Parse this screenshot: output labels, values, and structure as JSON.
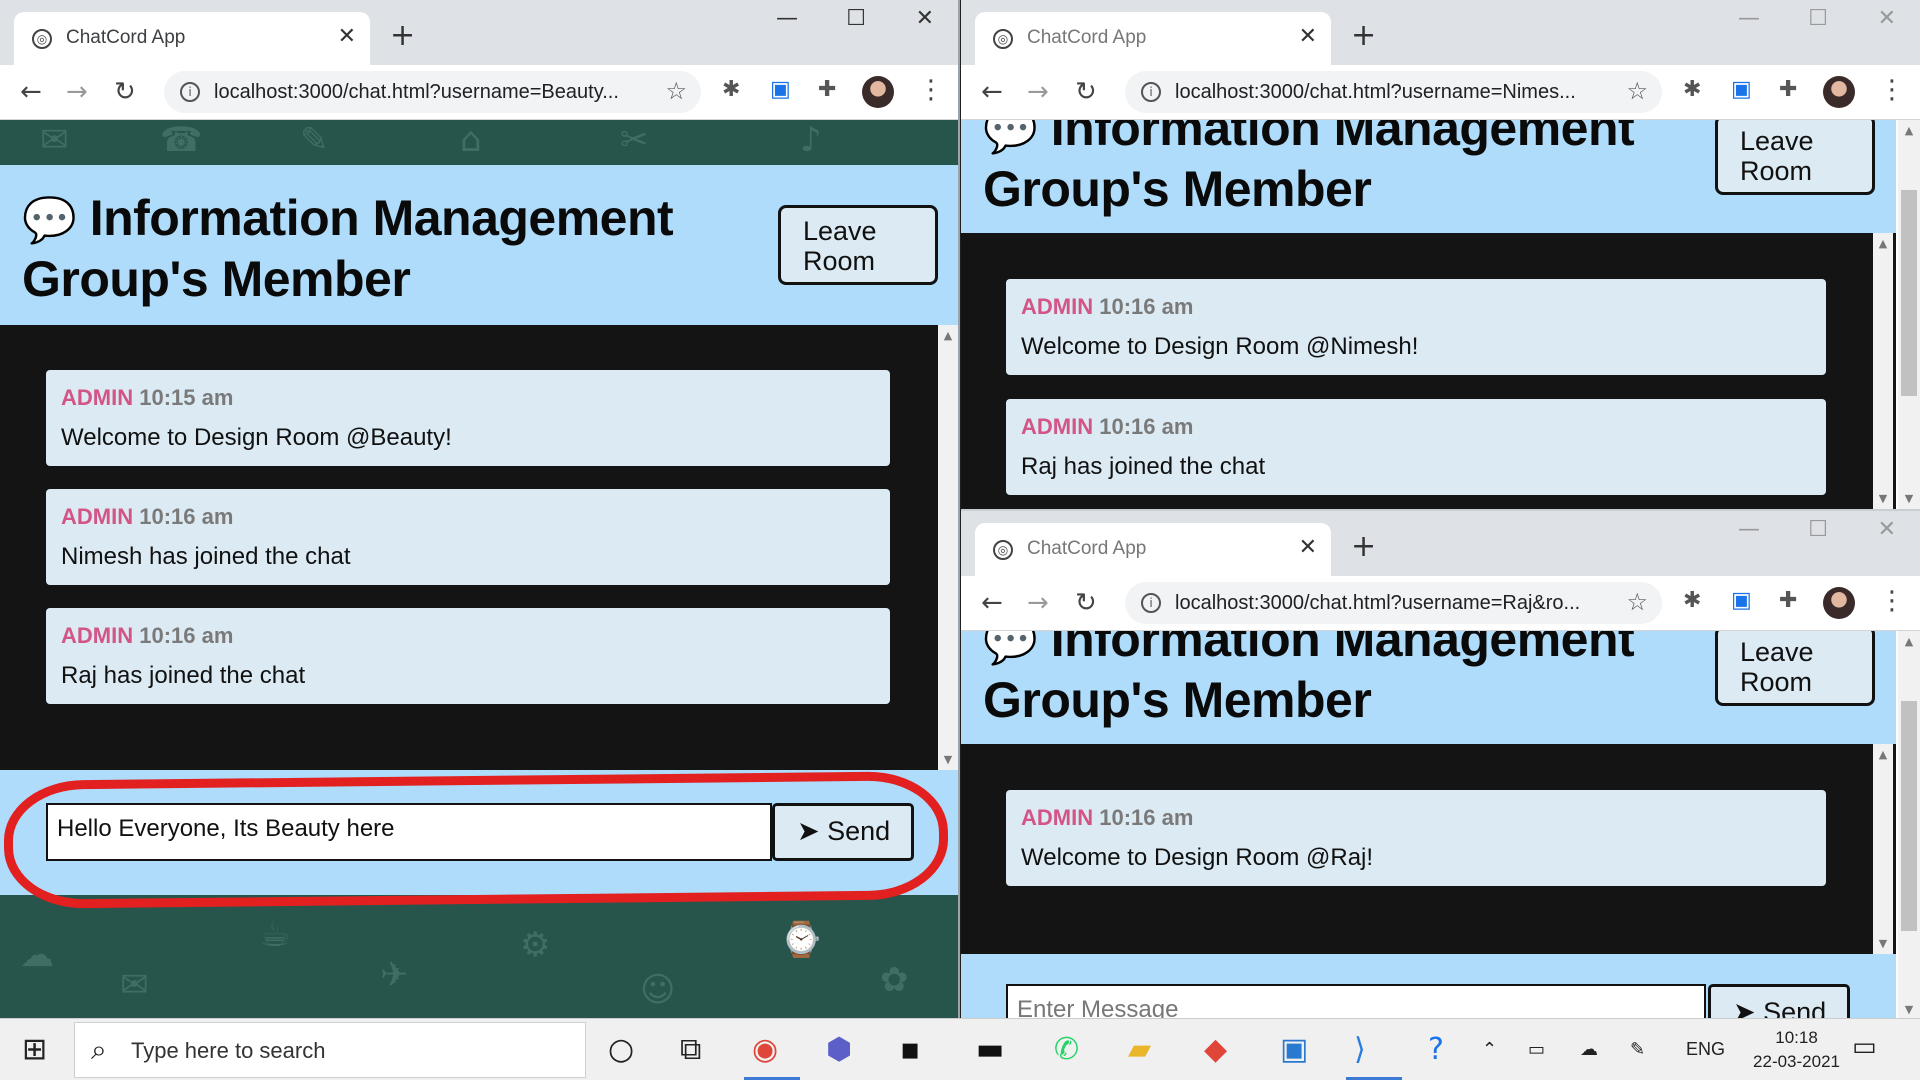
{
  "windows": [
    {
      "tab_title": "ChatCord App",
      "url": "localhost:3000/chat.html?username=Beauty...",
      "header": {
        "line1": "Information Management",
        "line2": "Group's Member",
        "leave": "Leave Room"
      },
      "messages": [
        {
          "user": "ADMIN",
          "time": "10:15 am",
          "text": "Welcome to Design Room @Beauty!"
        },
        {
          "user": "ADMIN",
          "time": "10:16 am",
          "text": "Nimesh has joined the chat"
        },
        {
          "user": "ADMIN",
          "time": "10:16 am",
          "text": "Raj has joined the chat"
        }
      ],
      "input_value": "Hello Everyone, Its Beauty here",
      "send": "Send"
    },
    {
      "tab_title": "ChatCord App",
      "url": "localhost:3000/chat.html?username=Nimes...",
      "header": {
        "line1": "Information Management",
        "line2": "Group's Member",
        "leave": "Leave Room"
      },
      "messages": [
        {
          "user": "ADMIN",
          "time": "10:16 am",
          "text": "Welcome to Design Room @Nimesh!"
        },
        {
          "user": "ADMIN",
          "time": "10:16 am",
          "text": "Raj has joined the chat"
        }
      ]
    },
    {
      "tab_title": "ChatCord App",
      "url": "localhost:3000/chat.html?username=Raj&ro...",
      "header": {
        "line1": "Information Management",
        "line2": "Group's Member",
        "leave": "Leave Room"
      },
      "messages": [
        {
          "user": "ADMIN",
          "time": "10:16 am",
          "text": "Welcome to Design Room @Raj!"
        }
      ],
      "input_placeholder": "Enter Message",
      "send": "Send"
    }
  ],
  "taskbar": {
    "search_placeholder": "Type here to search",
    "lang": "ENG",
    "time": "10:18",
    "date": "22-03-2021"
  },
  "colors": {
    "header_bg": "#aedcfa",
    "chat_bg": "#141414",
    "message_bg": "#dcebf3",
    "username": "#d25585",
    "annotation": "#e22020"
  }
}
